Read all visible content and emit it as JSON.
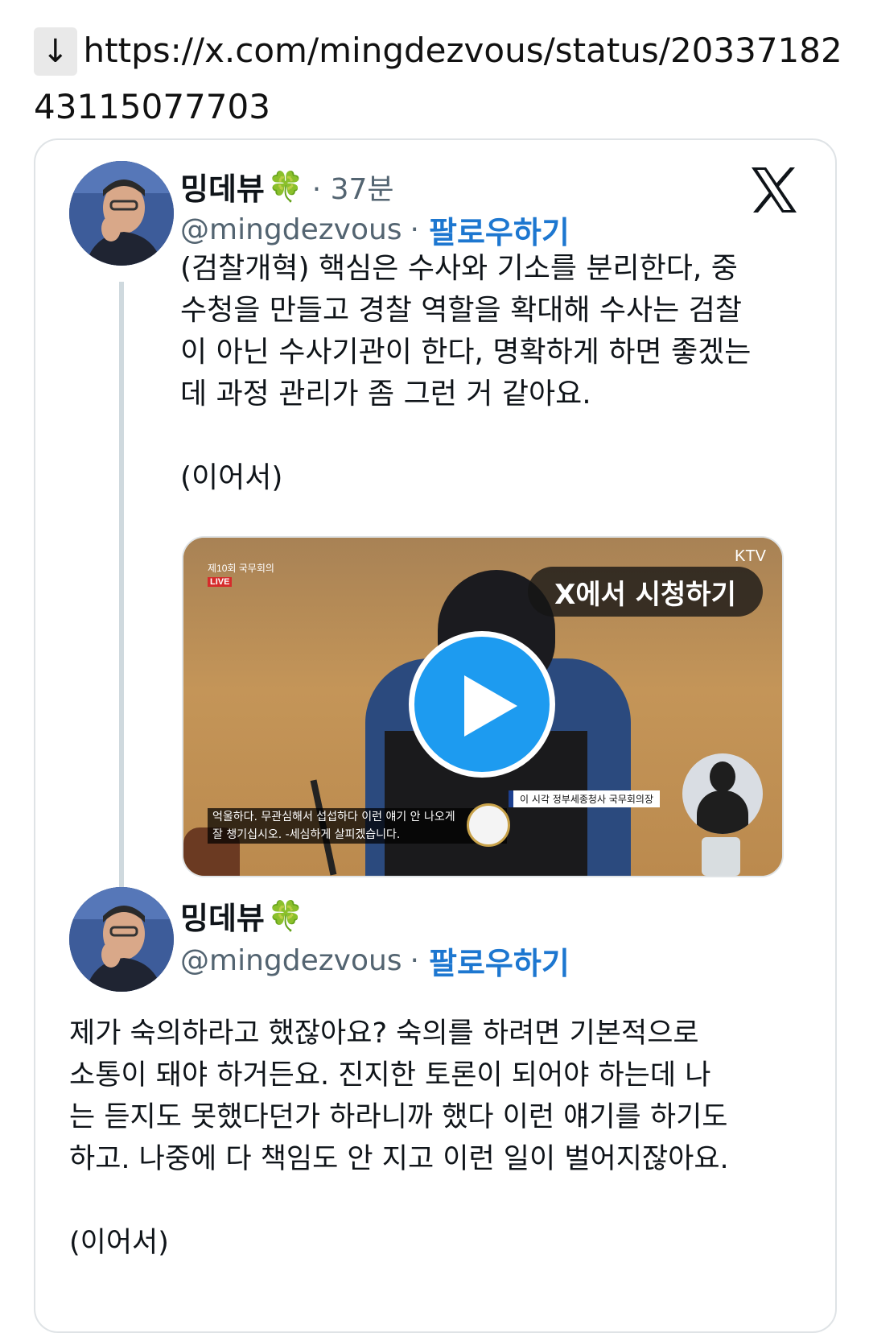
{
  "link": {
    "arrow": "↓",
    "url": "https://x.com/mingdezvous/status/2033718243115077703"
  },
  "tweet1": {
    "name": "밍데뷰",
    "clover": "🍀",
    "time": "· 37분",
    "handle": "@mingdezvous",
    "follow": "팔로우하기",
    "text": "(검찰개혁) 핵심은 수사와 기소를 분리한다, 중\n수청을 만들고 경찰 역할을 확대해 수사는 검찰\n이 아닌 수사기관이 한다, 명확하게 하면 좋겠는\n데 과정 관리가 좀 그런 거 같아요.\n\n(이어서)",
    "logo": "x-logo-icon"
  },
  "video": {
    "channel": "KTV",
    "program": "제10회 국무회의",
    "live": "LIVE",
    "watch": "X에서 시청하기",
    "caption_line1": "억울하다. 무관심해서 섭섭하다 이런 얘기 안 나오게",
    "caption_line2": "잘 챙기십시오. -세심하게 살피겠습니다.",
    "lower_third": "이 시각 정부세종청사 국무회의장",
    "play_icon": "play-icon"
  },
  "tweet2": {
    "name": "밍데뷰",
    "clover": "🍀",
    "handle": "@mingdezvous",
    "follow": "팔로우하기",
    "text": "제가 숙의하라고 했잖아요? 숙의를 하려면 기본적으로\n소통이 돼야 하거든요. 진지한 토론이 되어야 하는데 나\n는 듣지도 못했다던가 하라니까 했다 이런 얘기를 하기도\n하고. 나중에 다 책임도 안 지고 이런 일이 벌어지잖아요.\n\n(이어서)"
  },
  "colors": {
    "follow": "#1d77d0",
    "play": "#1d9bf0",
    "muted": "#536471"
  }
}
